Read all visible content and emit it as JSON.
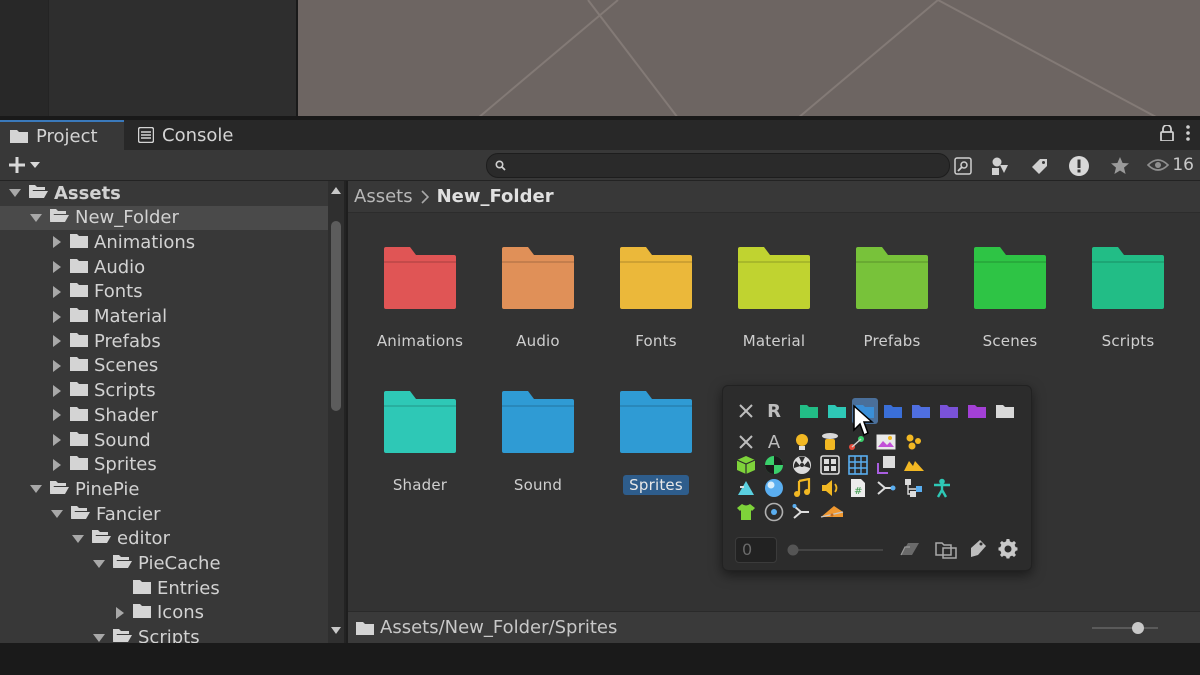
{
  "tabs": {
    "project": "Project",
    "console": "Console"
  },
  "toolbar": {
    "search_placeholder": "",
    "hidden_count": "16"
  },
  "tree": {
    "items": [
      {
        "label": "Assets",
        "depth": 0,
        "expanded": true
      },
      {
        "label": "New_Folder",
        "depth": 1,
        "expanded": true,
        "selected": true
      },
      {
        "label": "Animations",
        "depth": 2,
        "expanded": false
      },
      {
        "label": "Audio",
        "depth": 2,
        "expanded": false
      },
      {
        "label": "Fonts",
        "depth": 2,
        "expanded": false
      },
      {
        "label": "Material",
        "depth": 2,
        "expanded": false
      },
      {
        "label": "Prefabs",
        "depth": 2,
        "expanded": false
      },
      {
        "label": "Scenes",
        "depth": 2,
        "expanded": false
      },
      {
        "label": "Scripts",
        "depth": 2,
        "expanded": false
      },
      {
        "label": "Shader",
        "depth": 2,
        "expanded": false
      },
      {
        "label": "Sound",
        "depth": 2,
        "expanded": false
      },
      {
        "label": "Sprites",
        "depth": 2,
        "expanded": false
      },
      {
        "label": "PinePie",
        "depth": 1,
        "expanded": true
      },
      {
        "label": "Fancier",
        "depth": 2,
        "expanded": true
      },
      {
        "label": "editor",
        "depth": 3,
        "expanded": true
      },
      {
        "label": "PieCache",
        "depth": 4,
        "expanded": true
      },
      {
        "label": "Entries",
        "depth": 5,
        "leaf": true
      },
      {
        "label": "Icons",
        "depth": 5,
        "expanded": false
      },
      {
        "label": "Scripts",
        "depth": 4,
        "expanded": true
      }
    ]
  },
  "breadcrumb": {
    "root": "Assets",
    "current": "New_Folder"
  },
  "folders": [
    {
      "label": "Animations",
      "color": "#e05555"
    },
    {
      "label": "Audio",
      "color": "#e09058"
    },
    {
      "label": "Fonts",
      "color": "#ebb83a"
    },
    {
      "label": "Material",
      "color": "#c0d330"
    },
    {
      "label": "Prefabs",
      "color": "#78c23a"
    },
    {
      "label": "Scenes",
      "color": "#2ec445"
    },
    {
      "label": "Scripts",
      "color": "#22bd86"
    },
    {
      "label": "Shader",
      "color": "#2ec8b6"
    },
    {
      "label": "Sound",
      "color": "#2f9bd4"
    },
    {
      "label": "Sprites",
      "color": "#2f9bd4",
      "selected": true
    }
  ],
  "popup": {
    "clear_label": "R",
    "text_label": "A",
    "count_value": "0",
    "color_swatches": [
      "#22bd86",
      "#2ec8b6",
      "#3a8fd8",
      "#3a6fd8",
      "#4f6fe0",
      "#7a52d8",
      "#a340d6",
      "#d8d8d8"
    ],
    "icons": [
      "triangle-scene-icon",
      "sphere-icon",
      "music-note-icon",
      "speaker-icon",
      "script-file-icon",
      "branch-icon",
      "hierarchy-icon",
      "humanoid-icon",
      "shirt-icon",
      "target-icon",
      "shuffle-icon",
      "cheese-icon"
    ]
  },
  "status": {
    "path": "Assets/New_Folder/Sprites"
  }
}
